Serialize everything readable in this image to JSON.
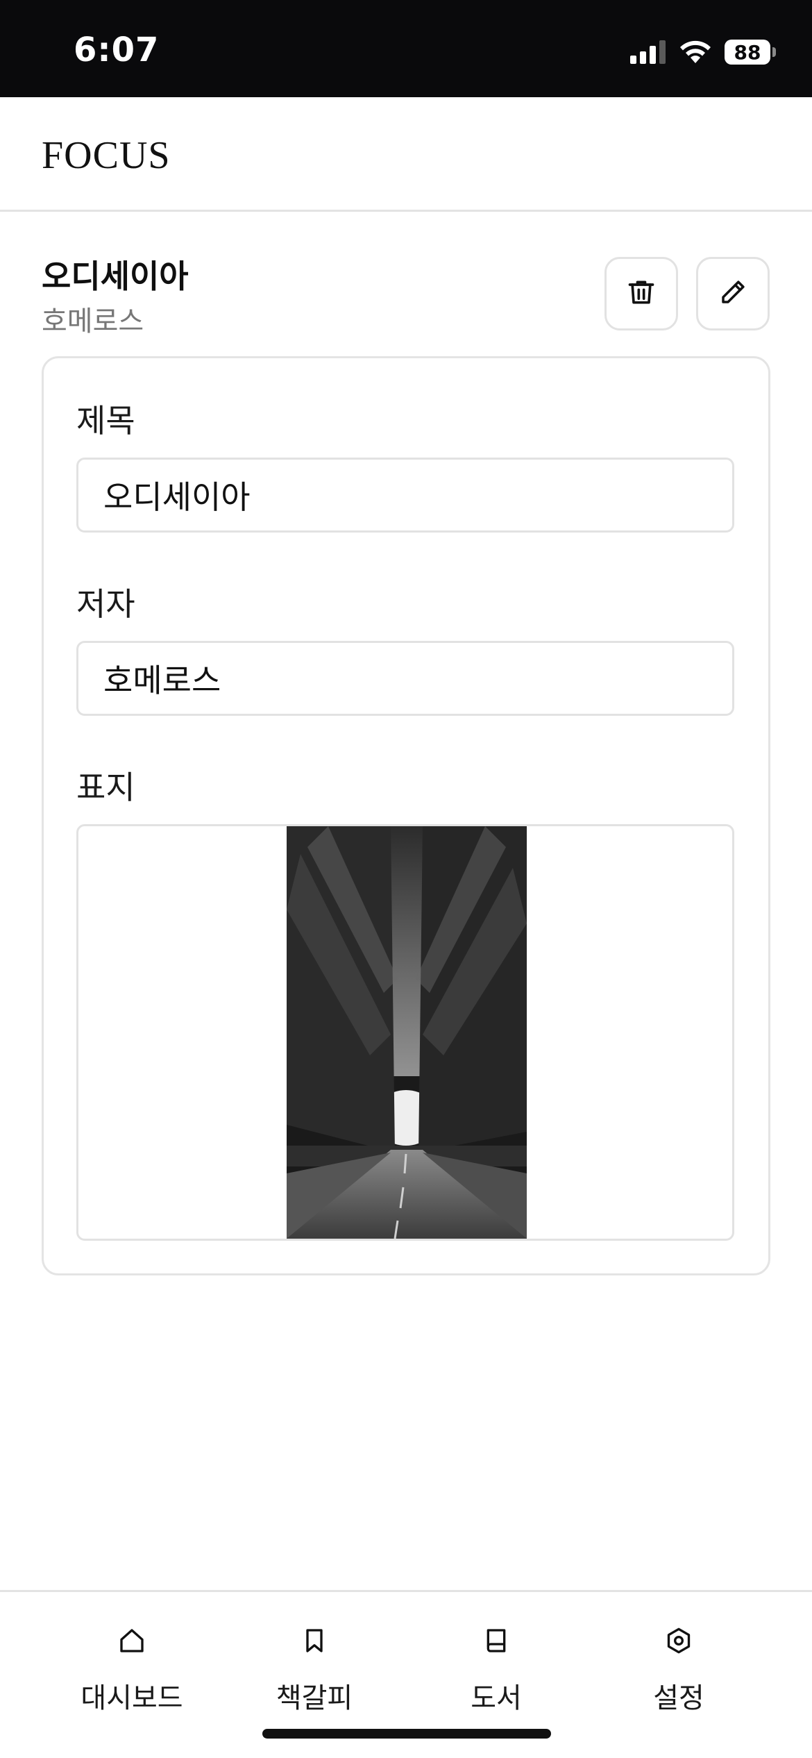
{
  "status_bar": {
    "time": "6:07",
    "battery": "88",
    "icons": [
      "signal-icon",
      "wifi-icon",
      "battery-icon"
    ]
  },
  "app": {
    "brand": "FOCUS"
  },
  "book": {
    "title": "오디세이아",
    "author": "호메로스",
    "actions": [
      "trash-icon",
      "pencil-icon"
    ]
  },
  "form": {
    "title_label": "제목",
    "title_value": "오디세이아",
    "author_label": "저자",
    "author_value": "호메로스",
    "cover_label": "표지"
  },
  "bottom_nav": {
    "items": [
      {
        "label": "대시보드",
        "icon": "home-icon"
      },
      {
        "label": "책갈피",
        "icon": "bookmark-icon"
      },
      {
        "label": "도서",
        "icon": "book-icon"
      },
      {
        "label": "설정",
        "icon": "settings-icon"
      }
    ]
  },
  "colors": {
    "status_bar_bg": "#0a0a0c",
    "border": "#e3e3e3",
    "muted_text": "#777777"
  }
}
